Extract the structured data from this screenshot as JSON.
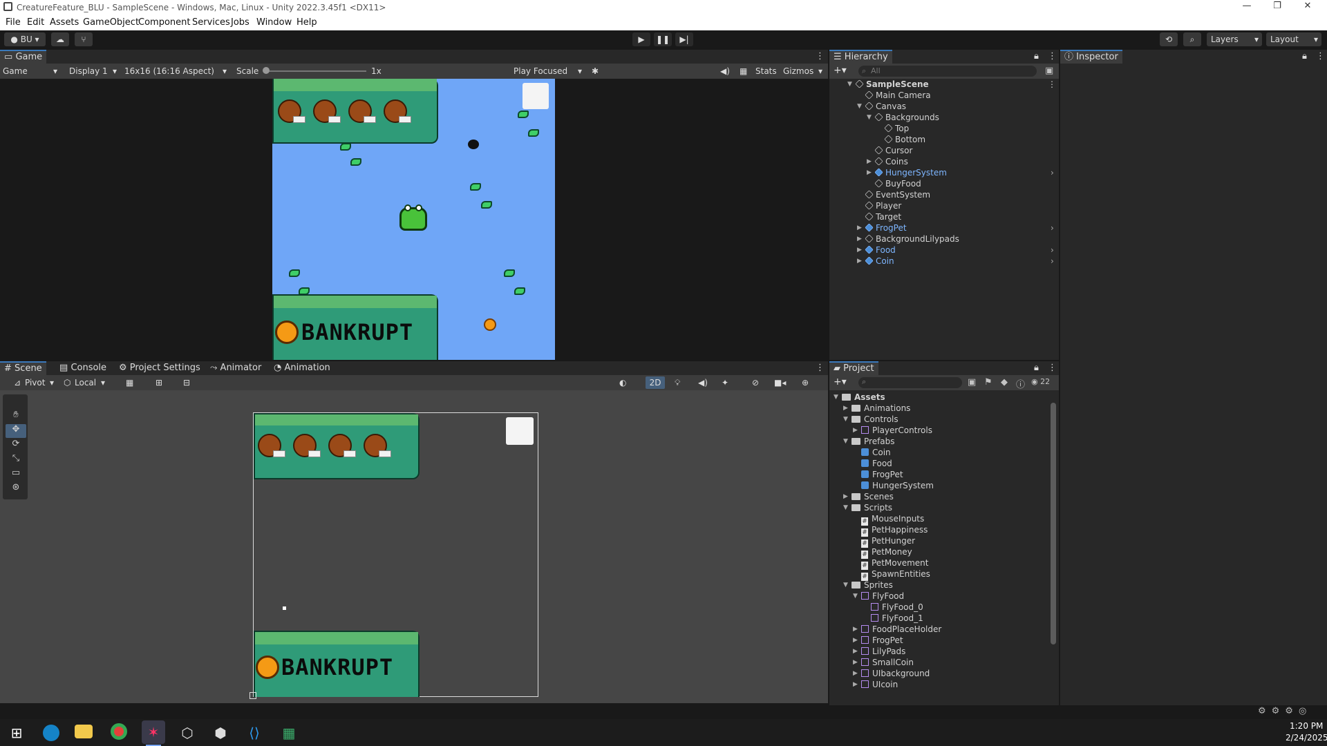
{
  "window": {
    "title": "CreatureFeature_BLU - SampleScene - Windows, Mac, Linux - Unity 2022.3.45f1 <DX11>",
    "controls": [
      "—",
      "❐",
      "✕"
    ]
  },
  "menu": [
    "File",
    "Edit",
    "Assets",
    "GameObject",
    "Component",
    "Services",
    "Jobs",
    "Window",
    "Help"
  ],
  "toolbar": {
    "account": "BU",
    "layers": "Layers",
    "layout": "Layout"
  },
  "game_view": {
    "tab": "Game",
    "mode": "Game",
    "display": "Display 1",
    "aspect": "16x16 (16:16 Aspect)",
    "scale_label": "Scale",
    "scale_value": "1x",
    "play_mode": "Play Focused",
    "stats": "Stats",
    "gizmos": "Gizmos",
    "banner_text": "BANKRUPT"
  },
  "hierarchy": {
    "tab": "Hierarchy",
    "search_placeholder": "All",
    "items": [
      {
        "label": "SampleScene",
        "depth": 0,
        "expand": "▼",
        "prefab": false,
        "bold": true
      },
      {
        "label": "Main Camera",
        "depth": 1,
        "expand": "",
        "prefab": false
      },
      {
        "label": "Canvas",
        "depth": 1,
        "expand": "▼",
        "prefab": false
      },
      {
        "label": "Backgrounds",
        "depth": 2,
        "expand": "▼",
        "prefab": false
      },
      {
        "label": "Top",
        "depth": 3,
        "expand": "",
        "prefab": false
      },
      {
        "label": "Bottom",
        "depth": 3,
        "expand": "",
        "prefab": false
      },
      {
        "label": "Cursor",
        "depth": 2,
        "expand": "",
        "prefab": false
      },
      {
        "label": "Coins",
        "depth": 2,
        "expand": "▶",
        "prefab": false
      },
      {
        "label": "HungerSystem",
        "depth": 2,
        "expand": "▶",
        "prefab": true
      },
      {
        "label": "BuyFood",
        "depth": 2,
        "expand": "",
        "prefab": false
      },
      {
        "label": "EventSystem",
        "depth": 1,
        "expand": "",
        "prefab": false
      },
      {
        "label": "Player",
        "depth": 1,
        "expand": "",
        "prefab": false
      },
      {
        "label": "Target",
        "depth": 1,
        "expand": "",
        "prefab": false
      },
      {
        "label": "FrogPet",
        "depth": 1,
        "expand": "▶",
        "prefab": true
      },
      {
        "label": "BackgroundLilypads",
        "depth": 1,
        "expand": "▶",
        "prefab": false
      },
      {
        "label": "Food",
        "depth": 1,
        "expand": "▶",
        "prefab": true
      },
      {
        "label": "Coin",
        "depth": 1,
        "expand": "▶",
        "prefab": true
      }
    ]
  },
  "inspector": {
    "tab": "Inspector"
  },
  "scene_view": {
    "tabs": [
      "Scene",
      "Console",
      "Project Settings",
      "Animator",
      "Animation"
    ],
    "pivot": "Pivot",
    "local": "Local",
    "mode_2d": "2D",
    "banner_text": "BANKRUPT"
  },
  "project": {
    "tab": "Project",
    "hidden_count": "22",
    "items": [
      {
        "label": "Assets",
        "depth": 0,
        "expand": "▼",
        "icon": "folder",
        "bold": true
      },
      {
        "label": "Animations",
        "depth": 1,
        "expand": "▶",
        "icon": "folder"
      },
      {
        "label": "Controls",
        "depth": 1,
        "expand": "▼",
        "icon": "folder"
      },
      {
        "label": "PlayerControls",
        "depth": 2,
        "expand": "▶",
        "icon": "asset"
      },
      {
        "label": "Prefabs",
        "depth": 1,
        "expand": "▼",
        "icon": "folder"
      },
      {
        "label": "Coin",
        "depth": 2,
        "expand": "",
        "icon": "prefab"
      },
      {
        "label": "Food",
        "depth": 2,
        "expand": "",
        "icon": "prefab"
      },
      {
        "label": "FrogPet",
        "depth": 2,
        "expand": "",
        "icon": "prefab"
      },
      {
        "label": "HungerSystem",
        "depth": 2,
        "expand": "",
        "icon": "prefab"
      },
      {
        "label": "Scenes",
        "depth": 1,
        "expand": "▶",
        "icon": "folder"
      },
      {
        "label": "Scripts",
        "depth": 1,
        "expand": "▼",
        "icon": "folder"
      },
      {
        "label": "MouseInputs",
        "depth": 2,
        "expand": "",
        "icon": "script"
      },
      {
        "label": "PetHappiness",
        "depth": 2,
        "expand": "",
        "icon": "script"
      },
      {
        "label": "PetHunger",
        "depth": 2,
        "expand": "",
        "icon": "script"
      },
      {
        "label": "PetMoney",
        "depth": 2,
        "expand": "",
        "icon": "script"
      },
      {
        "label": "PetMovement",
        "depth": 2,
        "expand": "",
        "icon": "script"
      },
      {
        "label": "SpawnEntities",
        "depth": 2,
        "expand": "",
        "icon": "script"
      },
      {
        "label": "Sprites",
        "depth": 1,
        "expand": "▼",
        "icon": "folder"
      },
      {
        "label": "FlyFood",
        "depth": 2,
        "expand": "▼",
        "icon": "sprite"
      },
      {
        "label": "FlyFood_0",
        "depth": 3,
        "expand": "",
        "icon": "sprite"
      },
      {
        "label": "FlyFood_1",
        "depth": 3,
        "expand": "",
        "icon": "sprite"
      },
      {
        "label": "FoodPlaceHolder",
        "depth": 2,
        "expand": "▶",
        "icon": "sprite"
      },
      {
        "label": "FrogPet",
        "depth": 2,
        "expand": "▶",
        "icon": "sprite"
      },
      {
        "label": "LilyPads",
        "depth": 2,
        "expand": "▶",
        "icon": "sprite"
      },
      {
        "label": "SmallCoin",
        "depth": 2,
        "expand": "▶",
        "icon": "sprite"
      },
      {
        "label": "UIbackground",
        "depth": 2,
        "expand": "▶",
        "icon": "sprite"
      },
      {
        "label": "UIcoin",
        "depth": 2,
        "expand": "▶",
        "icon": "sprite"
      }
    ]
  },
  "taskbar": {
    "time": "1:20 PM",
    "date": "2/24/2025"
  },
  "colors": {
    "accent": "#3a79bb",
    "prefab_text": "#7eb6ff",
    "game_water": "#6fa6f7",
    "panel_green": "#2f9b78"
  }
}
